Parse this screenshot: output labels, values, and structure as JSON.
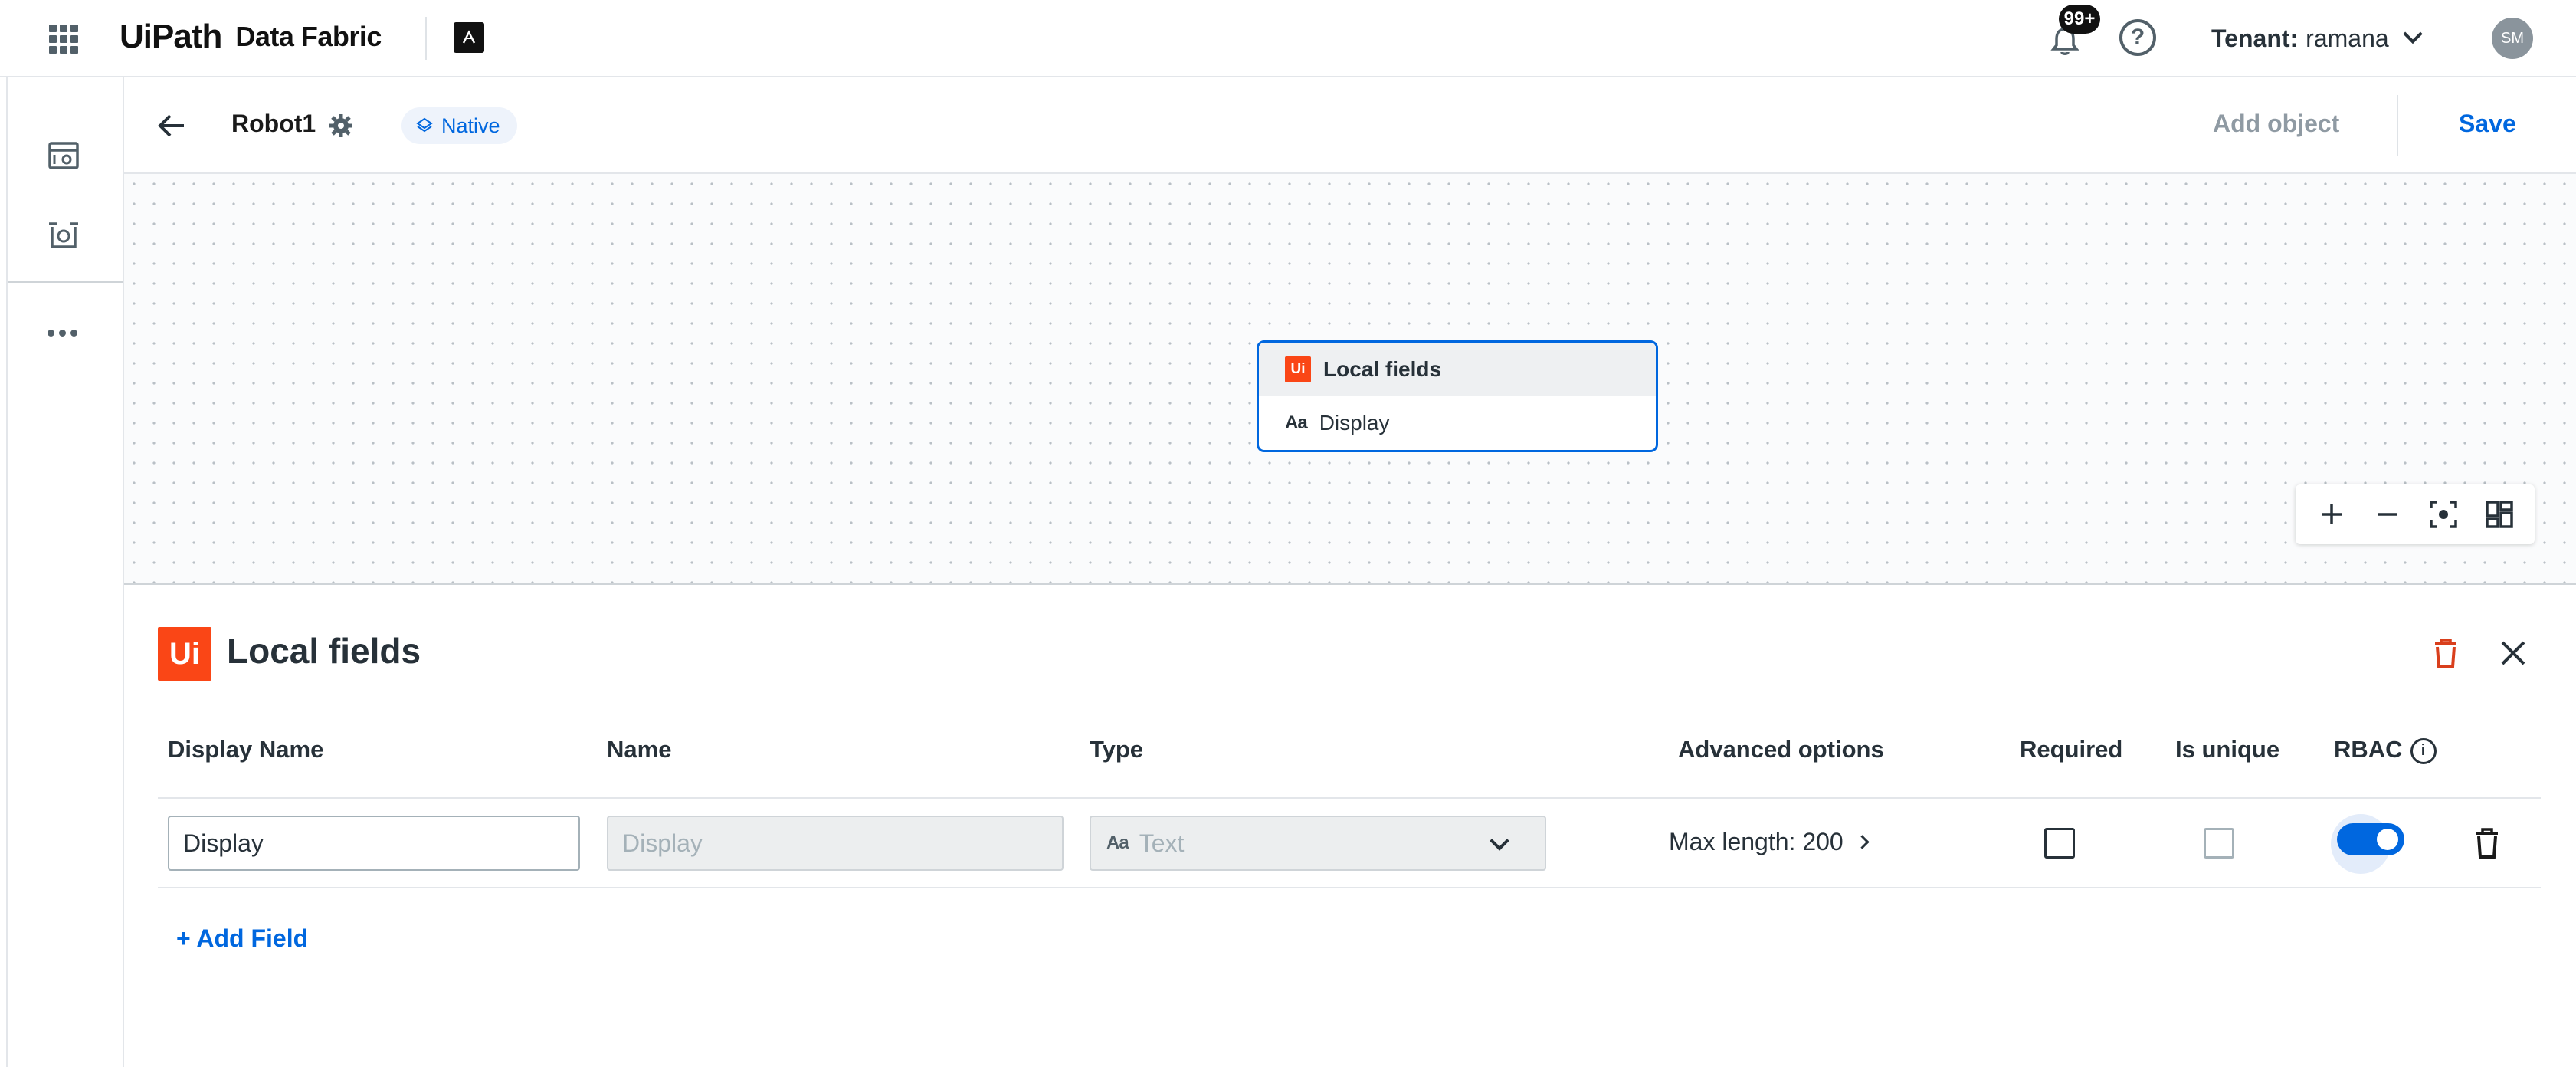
{
  "topbar": {
    "logo_ui": "Ui",
    "logo_path": "Path",
    "product": "Data Fabric",
    "notification_count": "99+",
    "help_glyph": "?",
    "tenant_label": "Tenant:",
    "tenant_value": "ramana",
    "avatar_initials": "SM"
  },
  "header": {
    "title": "Robot1",
    "badge": "Native",
    "add_object": "Add object",
    "save": "Save"
  },
  "canvas": {
    "node": {
      "title": "Local fields",
      "logo": "Ui",
      "fields": [
        {
          "type_glyph": "Aa",
          "label": "Display"
        }
      ]
    }
  },
  "panel": {
    "logo": "Ui",
    "title": "Local fields",
    "columns": {
      "display_name": "Display Name",
      "name": "Name",
      "type": "Type",
      "advanced": "Advanced options",
      "required": "Required",
      "unique": "Is unique",
      "rbac": "RBAC",
      "info_glyph": "i"
    },
    "rows": [
      {
        "display_name": "Display",
        "name": "Display",
        "type_glyph": "Aa",
        "type": "Text",
        "advanced": "Max length: 200",
        "required": false,
        "unique": false,
        "rbac": true
      }
    ],
    "add_field": "+ Add Field"
  },
  "colors": {
    "accent": "#0067df",
    "brand": "#fa4616",
    "danger": "#d93f1c"
  }
}
